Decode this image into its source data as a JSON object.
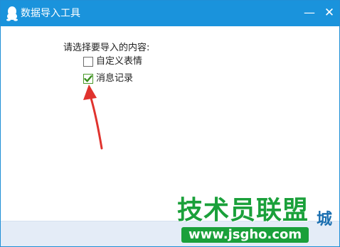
{
  "window": {
    "title": "数据导入工具",
    "app_icon": "qq-penguin-icon",
    "minimize_glyph": "—",
    "close_glyph": "✕"
  },
  "content": {
    "prompt": "请选择要导入的内容:",
    "options": [
      {
        "label": "自定义表情",
        "checked": false
      },
      {
        "label": "消息记录",
        "checked": true
      }
    ]
  },
  "annotation": {
    "arrow_color": "#e0332e"
  },
  "watermark": {
    "line1": "技术员联盟",
    "line2": "www.jsgho.com",
    "suffix": "城"
  },
  "colors": {
    "titlebar": "#1a93dc",
    "footer": "#e4ecf7",
    "check": "#3a8f1e",
    "watermark_green": "#1aa03a"
  }
}
